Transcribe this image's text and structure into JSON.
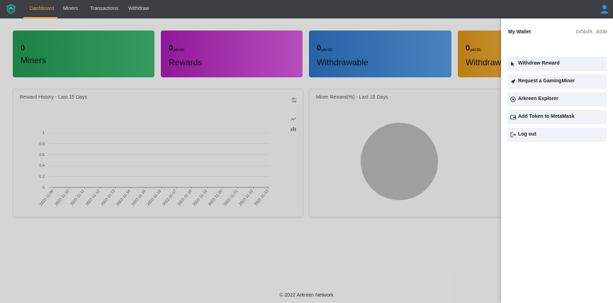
{
  "nav": {
    "items": [
      {
        "label": "Dashboard",
        "active": true
      },
      {
        "label": "Miners",
        "active": false
      },
      {
        "label": "Transactions",
        "active": false
      },
      {
        "label": "Withdraw",
        "active": false
      }
    ],
    "accent_color": "#e6a23c"
  },
  "cards": {
    "miners": {
      "value": "0",
      "label": "Miners"
    },
    "rewards": {
      "value": "0",
      "unit": "gAKRE",
      "label": "Rewards"
    },
    "withdrawable": {
      "value": "0",
      "unit": "gAKRE",
      "label": "Withdrawable"
    },
    "withdrawn": {
      "value": "0",
      "unit": "gAKRE",
      "label": "Withdrawe"
    }
  },
  "reward_history": {
    "title": "Reward History - Last 15 Days"
  },
  "miner_reward": {
    "title": "Miner Reward(%) - Last 15 Days"
  },
  "chart_data": {
    "type": "line",
    "title": "Reward History - Last 15 Days",
    "x": [
      "2022-11-09",
      "2022-11-10",
      "2022-11-11",
      "2022-11-12",
      "2022-11-13",
      "2022-11-14",
      "2022-11-15",
      "2022-11-16",
      "2022-11-17",
      "2022-11-18",
      "2022-11-19",
      "2022-11-20",
      "2022-11-21",
      "2022-11-22",
      "2022-11-23"
    ],
    "y_ticks": [
      "0",
      "0.2",
      "0.4",
      "0.6",
      "0.8",
      "1"
    ],
    "ylim": [
      0,
      1
    ],
    "series": [
      {
        "values": [
          0,
          0,
          0,
          0,
          0,
          0,
          0,
          0,
          0,
          0,
          0,
          0,
          0,
          0,
          0
        ]
      }
    ],
    "grid": true
  },
  "drawer": {
    "title": "My Wallet",
    "address": "0x5b49...8d3b",
    "menu": [
      {
        "label": "Withdraw Reward",
        "icon": "cursor-icon"
      },
      {
        "label": "Request a GamingMiner",
        "icon": "rocket-icon"
      },
      {
        "label": "Arkreen Explorer",
        "icon": "compass-icon"
      },
      {
        "label": "Add Token to MetaMask",
        "icon": "wallet-icon"
      },
      {
        "label": "Log out",
        "icon": "logout-icon"
      }
    ]
  },
  "footer": {
    "text": "© 2022 Arkreen Network"
  }
}
